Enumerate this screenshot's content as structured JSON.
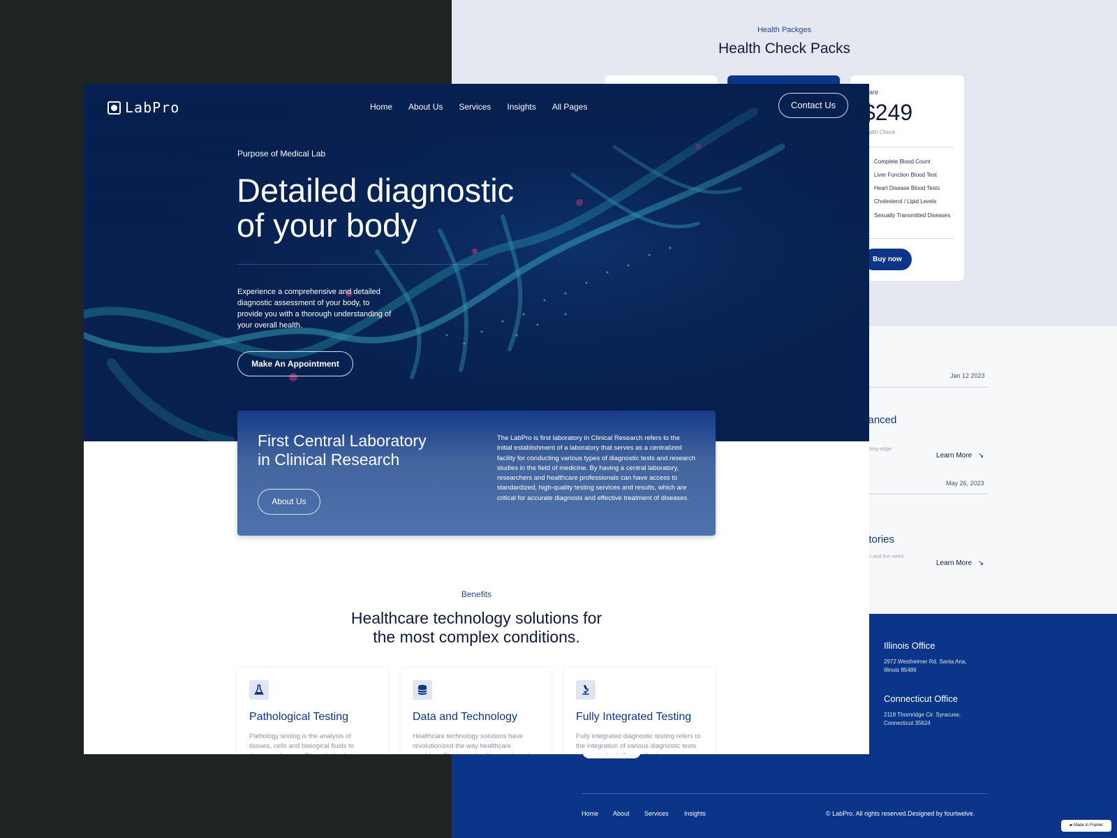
{
  "colors": {
    "brand_navy": "#0b3588",
    "hero_bg": "#07204f",
    "dark_bg": "#1f2321",
    "helix": "#3fb7c9",
    "accent_pink": "#c43a7a"
  },
  "site": {
    "logo_text": "LabPro",
    "nav": [
      "Home",
      "About Us",
      "Services",
      "Insights",
      "All Pages"
    ],
    "contact_label": "Contact Us"
  },
  "hero": {
    "eyebrow": "Purpose of Medical Lab",
    "title_line1": "Detailed diagnostic",
    "title_line2": "of your body",
    "description": "Experience a comprehensive and detailed diagnostic assessment of your body, to provide you with a thorough understanding of your overall health.",
    "cta_label": "Make An Appointment"
  },
  "lab_card": {
    "title_line1": "First Central Laboratory",
    "title_line2": "in Clinical Research",
    "button_label": "About Us",
    "body": "The LabPro is first laboratory in Clinical Research refers to the initial establishment of a laboratory that serves as a centralized facility for conducting various types of diagnostic tests and research studies in the field of medicine. By having a central laboratory, researchers and healthcare professionals can have access to standardized, high-quality testing services and results, which are critical for accurate diagnosis and effective treatment of diseases."
  },
  "benefits": {
    "eyebrow": "Benefits",
    "title_line1": "Healthcare technology solutions for",
    "title_line2": "the most complex conditions.",
    "cards": [
      {
        "icon": "flask-icon",
        "title": "Pathological Testing",
        "desc": "Pathology testing is the analysis of tissues, cells and biological fluids to diagnose disease. These technologies"
      },
      {
        "icon": "database-icon",
        "title": "Data and Technology",
        "desc": "Healthcare technology solutions have revolutionized the way healthcare providers. Electronic health records and"
      },
      {
        "icon": "microscope-icon",
        "title": "Fully Integrated Testing",
        "desc": "Fully integrated diagnostic testing refers to the integration of various diagnostic tests into a single platform, allowing"
      }
    ]
  },
  "packages": {
    "eyebrow": "Health Packges",
    "title": "Health Check Packs",
    "platinum": {
      "eyebrow": "Platinum Care",
      "price": "$249",
      "subtitle": "Platinum Health Check",
      "items": [
        "Complete Blood Count",
        "Liver Function Blood Test",
        "Heart Disease Blood Tests",
        "Cholesterol / Lipid Levels",
        "Sexually Transmitted Diseases"
      ],
      "buy_label": "Buy now"
    }
  },
  "insights": {
    "posts": [
      {
        "date": "Jan 12 2023",
        "title_fragment": "vanced",
        "snippet_fragment": "cutting-edge",
        "more_label": "Learn More"
      },
      {
        "date": "May 26, 2023",
        "title_fragment": "atories",
        "snippet_fragment": "tion and the need",
        "more_label": "Learn More"
      }
    ]
  },
  "footer": {
    "offices": [
      {
        "title": "Illinois Office",
        "line1": "2972 Westheimer Rd. Santa Ana,",
        "line2": "Illinois 85486"
      },
      {
        "title": "Connecticut Office",
        "line1": "2118 Thornridge Cir. Syracuse,",
        "line2": "Connecticut 35624"
      }
    ],
    "links": [
      "Home",
      "About",
      "Services",
      "Insights"
    ],
    "copyright": "© LabPro. All rights reserved.Designed by fourtwelve.",
    "framer_badge": "Made in Framer"
  }
}
